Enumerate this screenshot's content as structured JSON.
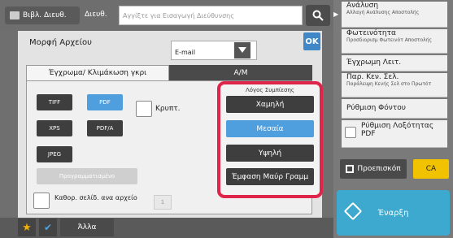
{
  "topbar": {
    "address_book_label": "Βιβλ. Διευθ.",
    "address_label": "Διευθ.",
    "address_placeholder": "Αγγίξτε για Εισαγωγή Διεύθυνσης"
  },
  "panel": {
    "format_label": "Μορφή Αρχείου",
    "format_value": "E-mail",
    "ok_label": "OK",
    "tabs": [
      {
        "label": "Έγχρωμα/ Κλιμάκωση γκρι"
      },
      {
        "label": "Α/Μ"
      }
    ],
    "format_buttons": [
      {
        "label": "TIFF"
      },
      {
        "label": "PDF",
        "selected": true
      },
      {
        "label": "XPS"
      },
      {
        "label": "PDF/A"
      },
      {
        "label": "JPEG"
      }
    ],
    "programmed_label": "Προγραμματισμένο",
    "encrypt_label": "Κρυπτ.",
    "pages_label": "Καθορ. σελίδ. ανα αρχείο",
    "pages_value": "1",
    "compression": {
      "title": "Λόγος Συμπίεσης",
      "options": [
        {
          "label": "Χαμηλή"
        },
        {
          "label": "Μεσαία",
          "selected": true
        },
        {
          "label": "Υψηλή"
        },
        {
          "label": "Έμφαση Μαύρ Γραμμ"
        }
      ]
    }
  },
  "bottombar": {
    "other_label": "Άλλα"
  },
  "sidebar": {
    "items": [
      {
        "title": "Ανάλυση",
        "subtitle": "Αλλαγή Ανάλυσης Αποστολής"
      },
      {
        "title": "Φωτεινότητα",
        "subtitle": "Προσδιορισμ Φωτεινότ Αποστολής"
      },
      {
        "title": "Έγχρωμη Λειτ.",
        "subtitle": ""
      },
      {
        "title": "Παρ. Κεν. Σελ.",
        "subtitle": "Παράλειψη Κενής Σελ στο Πρωτότ"
      },
      {
        "title": "Ρύθμιση Φόντου",
        "subtitle": ""
      },
      {
        "title": "Ρύθμιση Λοξότητας PDF",
        "subtitle": ""
      }
    ],
    "preview_label": "Προεπισκόπ",
    "ca_label": "CA",
    "start_label": "Έναρξη"
  },
  "colors": {
    "accent_blue": "#4f9ede",
    "highlight_red": "#e0254a",
    "start_teal": "#3da9cf",
    "ca_yellow": "#f0c200"
  }
}
